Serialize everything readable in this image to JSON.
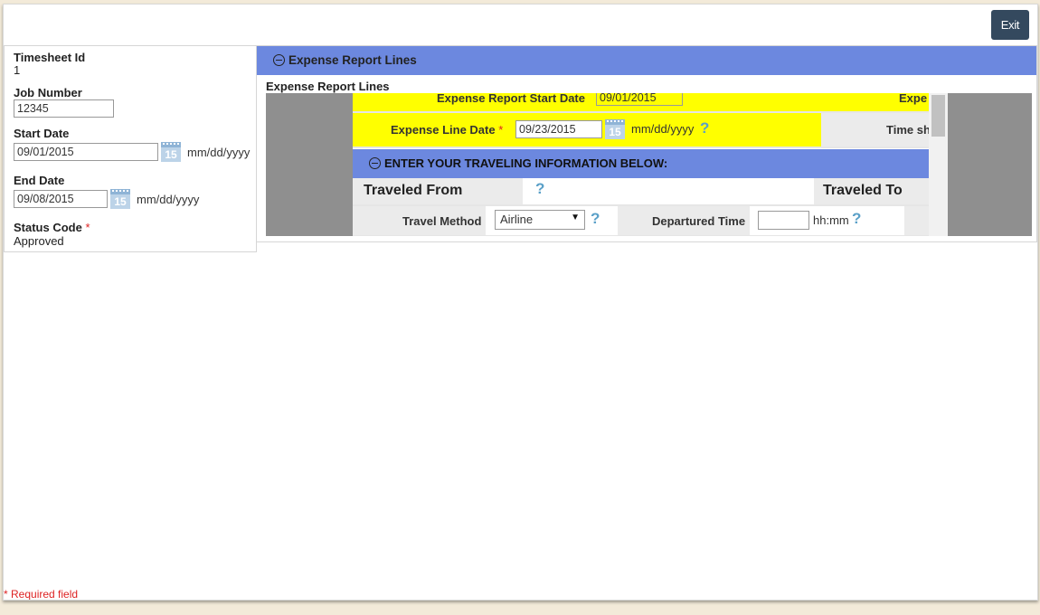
{
  "toolbar": {
    "exit_label": "Exit"
  },
  "left": {
    "timesheet_id_label": "Timesheet Id",
    "timesheet_id_value": "1",
    "job_number_label": "Job Number",
    "job_number_value": "12345",
    "start_date_label": "Start Date",
    "start_date_value": "09/01/2015",
    "end_date_label": "End Date",
    "end_date_value": "09/08/2015",
    "status_code_label": "Status Code",
    "status_code_value": "Approved",
    "date_format": "mm/dd/yyyy",
    "required_marker": "*",
    "calendar_day": "15"
  },
  "expense": {
    "header": "Expense Report Lines",
    "subtitle": "Expense Report Lines",
    "report_start_date_label": "Expense Report Start Date",
    "report_start_date_value": "09/01/2015",
    "report_end_label_partial": "Expe",
    "line_date_label": "Expense Line Date",
    "line_date_value": "09/23/2015",
    "date_format": "mm/dd/yyyy",
    "time_label_partial": "Time sh",
    "travel_section_header": "ENTER YOUR TRAVELING INFORMATION BELOW:",
    "traveled_from_label": "Traveled From",
    "traveled_to_label": "Traveled To",
    "travel_method_label": "Travel Method",
    "travel_method_value": "Airline",
    "departured_time_label": "Departured Time",
    "departured_time_value": "",
    "time_format": "hh:mm",
    "help_glyph": "?"
  },
  "footer": {
    "required_note": "* Required field"
  },
  "colors": {
    "header_blue": "#6c88df",
    "highlight_yellow": "#ffff00",
    "exit_bg": "#34495e",
    "required_red": "#dd2222"
  }
}
